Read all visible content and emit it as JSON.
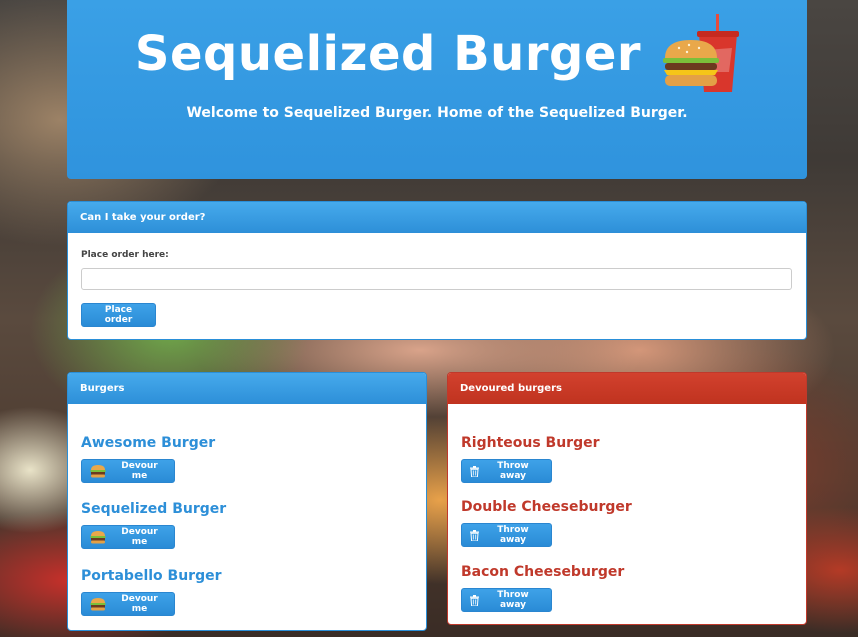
{
  "header": {
    "title": "Sequelized Burger",
    "subtitle": "Welcome to Sequelized Burger. Home of the Sequelized Burger.",
    "logo_icon": "burger-soda-icon"
  },
  "order_panel": {
    "heading": "Can I take your order?",
    "input_label": "Place order here:",
    "input_value": "",
    "button_label": "Place order"
  },
  "burgers_panel": {
    "heading": "Burgers",
    "button_icon": "burger-icon",
    "items": [
      {
        "name": "Awesome Burger",
        "button_label": "Devour me"
      },
      {
        "name": "Sequelized Burger",
        "button_label": "Devour me"
      },
      {
        "name": "Portabello Burger",
        "button_label": "Devour me"
      }
    ]
  },
  "devoured_panel": {
    "heading": "Devoured burgers",
    "button_icon": "trash-icon",
    "items": [
      {
        "name": "Righteous Burger",
        "button_label": "Throw away"
      },
      {
        "name": "Double Cheeseburger",
        "button_label": "Throw away"
      },
      {
        "name": "Bacon Cheeseburger",
        "button_label": "Throw away"
      }
    ]
  },
  "colors": {
    "primary": "#2f93dd",
    "danger": "#c0392b",
    "white": "#ffffff"
  }
}
